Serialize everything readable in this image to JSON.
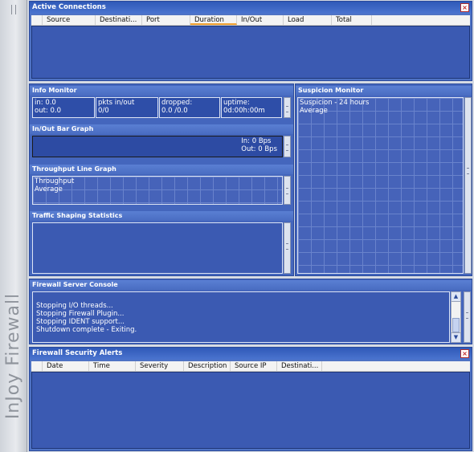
{
  "brand": {
    "label": "InJoy Firewall"
  },
  "active_connections": {
    "title": "Active Connections",
    "columns": [
      "Source",
      "Destinati...",
      "Port",
      "Duration",
      "In/Out",
      "Load",
      "Total"
    ],
    "sorted_column": "Duration"
  },
  "info_monitor": {
    "title": "Info Monitor",
    "in": "in: 0.0",
    "out": "out: 0.0",
    "pkts_label": "pkts in/out",
    "pkts_value": "0/0",
    "dropped_label": "dropped:",
    "dropped_value": "0.0 /0.0",
    "uptime_label": "uptime:",
    "uptime_value": "0d:00h:00m"
  },
  "inout_bar_graph": {
    "title": "In/Out Bar Graph",
    "in": "In: 0 Bps",
    "out": "Out: 0 Bps"
  },
  "throughput_line_graph": {
    "title": "Throughput Line Graph",
    "legend_throughput": "Throughput",
    "legend_average": "Average"
  },
  "traffic_shaping": {
    "title": "Traffic Shaping Statistics"
  },
  "suspicion_monitor": {
    "title": "Suspicion Monitor",
    "legend_main": "Suspicion - 24 hours",
    "legend_average": "Average"
  },
  "console": {
    "title": "Firewall Server Console",
    "lines": [
      "Stopping I/O threads...",
      "Stopping Firewall Plugin...",
      "Stopping IDENT support...",
      "Shutdown complete - Exiting."
    ]
  },
  "alerts": {
    "title": "Firewall Security Alerts",
    "columns": [
      "Date",
      "Time",
      "Severity",
      "Description",
      "Source IP",
      "Destinati..."
    ]
  },
  "colors": {
    "pane_bg": "#4e72c4",
    "list_bg": "#3b5ab2",
    "title_bar": "#2f59b8",
    "accent_sort": "#f0a030"
  }
}
